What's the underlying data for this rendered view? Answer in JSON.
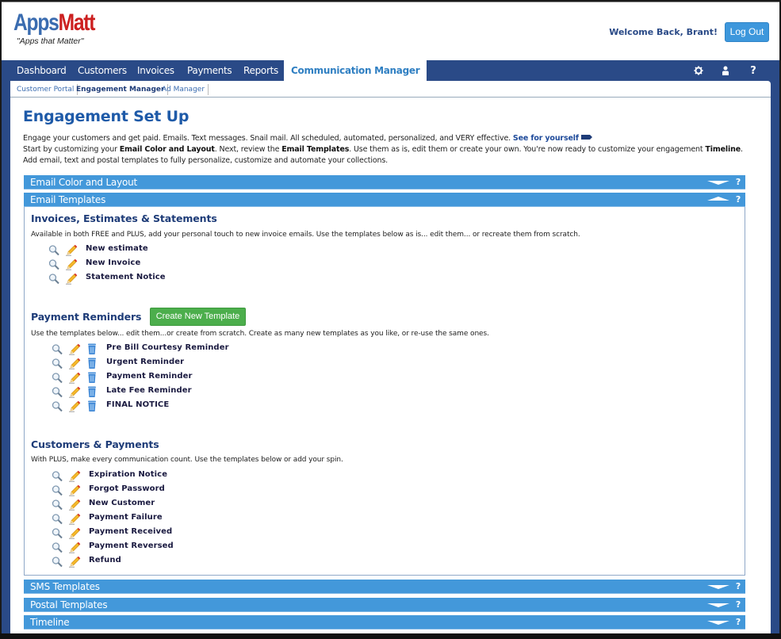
{
  "brand": {
    "logo_part1": "Apps",
    "logo_part2": "Matt",
    "tagline": "\"Apps that Matter\"",
    "colors": {
      "nav": "#2a4a87",
      "accent": "#4398da",
      "logo_blue": "#3a6cb0",
      "logo_red": "#cc1f1f",
      "create_green": "#4cae4c"
    }
  },
  "header": {
    "welcome": "Welcome Back, Brant!",
    "logout_label": "Log Out"
  },
  "nav": {
    "items": [
      {
        "label": "Dashboard"
      },
      {
        "label": "Customers"
      },
      {
        "label": "Invoices"
      },
      {
        "label": "Payments"
      },
      {
        "label": "Reports"
      },
      {
        "label": "Communication Manager",
        "active": true
      }
    ],
    "icons": [
      {
        "name": "gear-icon",
        "glyph": "⚙"
      },
      {
        "name": "user-icon",
        "glyph": "👤"
      },
      {
        "name": "help-icon",
        "glyph": "?"
      }
    ]
  },
  "subnav": {
    "items": [
      {
        "label": "Customer Portal"
      },
      {
        "label": "Engagement Manager",
        "active": true
      },
      {
        "label": "Ad Manager"
      }
    ]
  },
  "page": {
    "title": "Engagement Set Up",
    "intro_line1": "Engage your customers and get paid. Emails. Text messages. Snail mail. All scheduled, automated, personalized, and VERY effective.",
    "intro_link": "See for yourself",
    "intro_line2_a": "Start by customizing your ",
    "intro_line2_b": "Email Color and Layout",
    "intro_line2_c": ". Next, review the ",
    "intro_line2_d": "Email Templates",
    "intro_line2_e": ". Use them as is, edit them or create your own. You're now ready to customize your engagement ",
    "intro_line2_f": "Timeline",
    "intro_line2_g": ".",
    "intro_line3": "Add email, text and postal templates to fully personalize, customize and automate your collections."
  },
  "accordions": {
    "email_color": {
      "label": "Email Color and Layout",
      "expanded": false,
      "help": "?"
    },
    "email_templates": {
      "label": "Email Templates",
      "expanded": true,
      "help": "?"
    },
    "sms": {
      "label": "SMS Templates",
      "expanded": false,
      "help": "?"
    },
    "postal": {
      "label": "Postal Templates",
      "expanded": false,
      "help": "?"
    },
    "timeline": {
      "label": "Timeline",
      "expanded": false,
      "help": "?"
    }
  },
  "sections": {
    "invoices": {
      "title": "Invoices, Estimates & Statements",
      "desc": "Available in both FREE and PLUS, add your personal touch to new invoice emails. Use the templates below as is... edit them... or recreate them from scratch.",
      "templates": [
        "New estimate",
        "New Invoice",
        "Statement Notice"
      ]
    },
    "reminders": {
      "title": "Payment Reminders",
      "create_label": "Create New Template",
      "desc": "Use the templates below... edit them...or create from scratch. Create as many new templates as you like, or re-use the same ones.",
      "templates": [
        "Pre Bill Courtesy Reminder",
        "Urgent Reminder",
        "Payment Reminder",
        "Late Fee Reminder",
        "FINAL NOTICE"
      ]
    },
    "customers": {
      "title": "Customers & Payments",
      "desc": "With PLUS, make every communication count. Use the templates below or add your spin.",
      "templates": [
        "Expiration Notice",
        "Forgot Password",
        "New Customer",
        "Payment Failure",
        "Payment Received",
        "Payment Reversed",
        "Refund"
      ]
    }
  }
}
